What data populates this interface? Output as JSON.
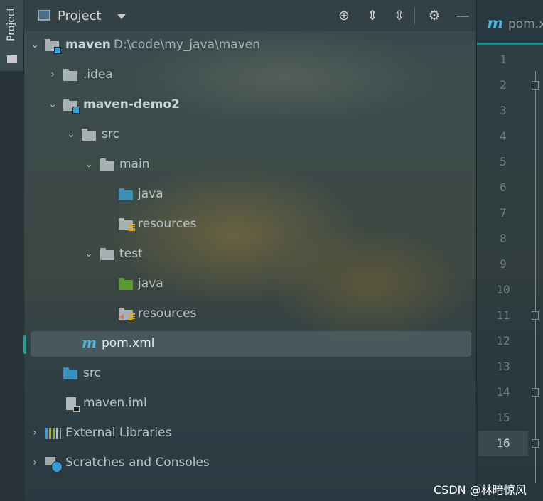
{
  "side_stripe": {
    "tab_label": "Project"
  },
  "header": {
    "title": "Project",
    "tools": [
      {
        "name": "locate-icon",
        "glyph": "⊕"
      },
      {
        "name": "expand-all-icon",
        "glyph": "⇕"
      },
      {
        "name": "collapse-all-icon",
        "glyph": "⇳"
      },
      {
        "name": "gear-icon",
        "glyph": "⚙"
      },
      {
        "name": "hide-icon",
        "glyph": "—"
      }
    ]
  },
  "tree": {
    "root": {
      "label": "maven",
      "path": "D:\\code\\my_java\\maven"
    },
    "idea": {
      "label": ".idea"
    },
    "module": {
      "label": "maven-demo2"
    },
    "src": {
      "label": "src"
    },
    "main": {
      "label": "main"
    },
    "main_java": {
      "label": "java"
    },
    "main_resources": {
      "label": "resources"
    },
    "test": {
      "label": "test"
    },
    "test_java": {
      "label": "java"
    },
    "test_resources": {
      "label": "resources"
    },
    "pom": {
      "icon_letter": "m",
      "label": "pom.xml"
    },
    "root_src": {
      "label": "src"
    },
    "iml": {
      "label": "maven.iml"
    },
    "external_libraries": {
      "label": "External Libraries"
    },
    "scratches": {
      "label": "Scratches and Consoles"
    }
  },
  "editor": {
    "tab_icon_letter": "m",
    "tab_label": "pom.x",
    "line_numbers": [
      "1",
      "2",
      "3",
      "4",
      "5",
      "6",
      "7",
      "8",
      "9",
      "10",
      "11",
      "12",
      "13",
      "14",
      "15",
      "16"
    ],
    "current_line": "16"
  },
  "watermark": "CSDN @林暗惊风"
}
